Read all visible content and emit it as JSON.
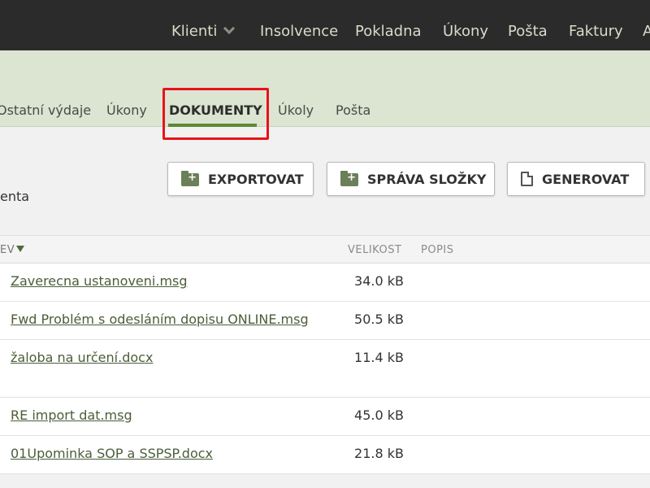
{
  "topnav": {
    "items": [
      "Klienti",
      "Insolvence",
      "Pokladna",
      "Úkony",
      "Pošta",
      "Faktury",
      "A"
    ]
  },
  "subnav": {
    "tabs": [
      "Ostatní výdaje",
      "Úkony",
      "DOKUMENTY",
      "Úkoly",
      "Pošta"
    ],
    "active": "DOKUMENTY"
  },
  "toolbar": {
    "partial_label": "enta",
    "export_label": "EXPORTOVAT",
    "folder_label": "SPRÁVA SLOŽKY",
    "generate_label": "GENEROVAT"
  },
  "table": {
    "headers": {
      "name": "EV",
      "size": "VELIKOST",
      "desc": "POPIS"
    },
    "rows": [
      {
        "name": "Zaverecna ustanoveni.msg",
        "size": "34.0 kB"
      },
      {
        "name": "Fwd Problém s odesláním dopisu ONLINE.msg",
        "size": "50.5 kB"
      },
      {
        "name": "žaloba na určení.docx",
        "size": "11.4 kB"
      },
      {
        "name": "RE import dat.msg",
        "size": "45.0 kB"
      },
      {
        "name": "01Upominka SOP a SSPSP.docx",
        "size": "21.8 kB"
      }
    ]
  },
  "colors": {
    "accent": "#5b8a34",
    "highlight": "#e8121b",
    "nav_bg": "#2b2b2b",
    "subnav_bg": "#dbe5d1"
  }
}
